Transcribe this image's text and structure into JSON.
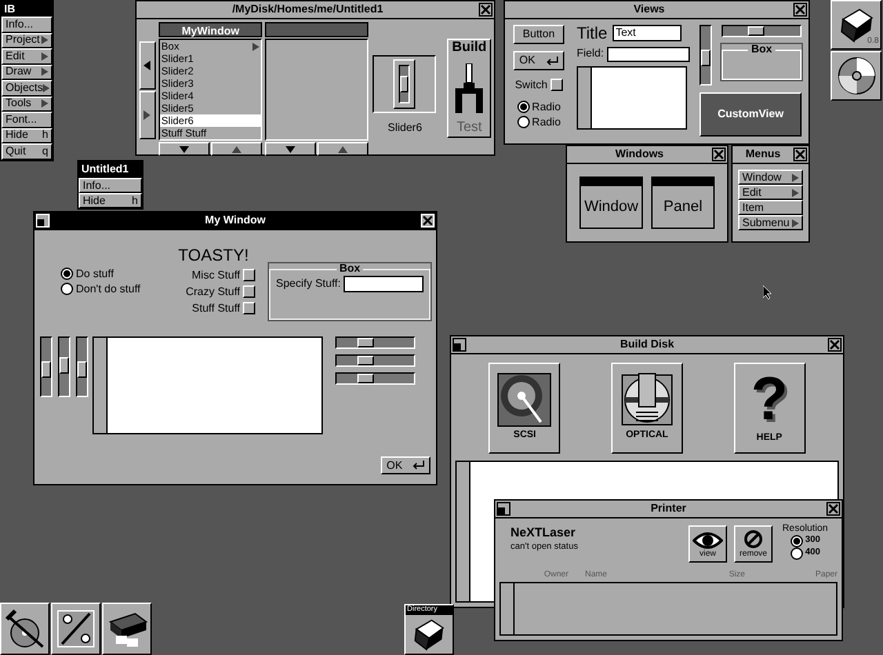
{
  "main_menu": {
    "title": "IB",
    "items": [
      {
        "label": "Info...",
        "kind": "plain"
      },
      {
        "label": "Project",
        "kind": "submenu"
      },
      {
        "label": "Edit",
        "kind": "submenu"
      },
      {
        "label": "Draw",
        "kind": "submenu"
      },
      {
        "label": "Objects",
        "kind": "submenu"
      },
      {
        "label": "Tools",
        "kind": "submenu"
      },
      {
        "label": "Font...",
        "kind": "plain"
      },
      {
        "label": "Hide",
        "kind": "shortcut",
        "shortcut": "h"
      },
      {
        "label": "Quit",
        "kind": "shortcut",
        "shortcut": "q"
      }
    ]
  },
  "document_menu": {
    "title": "Untitled1",
    "items": [
      {
        "label": "Info...",
        "kind": "plain"
      },
      {
        "label": "Hide",
        "kind": "shortcut",
        "shortcut": "h"
      }
    ]
  },
  "browser_window": {
    "title": "/MyDisk/Homes/me/Untitled1",
    "active": false,
    "column_title": "MyWindow",
    "items": [
      {
        "label": "Box",
        "kind": "branch",
        "selected": false
      },
      {
        "label": "Slider1",
        "kind": "leaf",
        "selected": false
      },
      {
        "label": "Slider2",
        "kind": "leaf",
        "selected": false
      },
      {
        "label": "Slider3",
        "kind": "leaf",
        "selected": false
      },
      {
        "label": "Slider4",
        "kind": "leaf",
        "selected": false
      },
      {
        "label": "Slider5",
        "kind": "leaf",
        "selected": false
      },
      {
        "label": "Slider6",
        "kind": "leaf",
        "selected": true
      },
      {
        "label": "Stuff Stuff",
        "kind": "leaf",
        "selected": false
      }
    ],
    "inspector_label": "Slider6",
    "inspector_slider": {
      "level": 0.5
    },
    "build_label": "Build",
    "test_label": "Test"
  },
  "views_window": {
    "title": "Views",
    "active": false,
    "button": "Button",
    "ok_button": "OK",
    "switch": {
      "label": "Switch",
      "checked": false
    },
    "radios": [
      {
        "label": "Radio",
        "selected": true
      },
      {
        "label": "Radio",
        "selected": false
      }
    ],
    "title_label": "Title",
    "text_field": "Text",
    "field_label": "Field:",
    "vertical_slider": {
      "level": 0.45
    },
    "horizontal_slider": {
      "level": 0.4
    },
    "box_title": "Box",
    "custom_view": "CustomView"
  },
  "windows_palette": {
    "title": "Windows",
    "active": false,
    "items": [
      "Window",
      "Panel"
    ]
  },
  "menus_palette": {
    "title": "Menus",
    "active": false,
    "items": [
      {
        "label": "Window",
        "kind": "submenu"
      },
      {
        "label": "Edit",
        "kind": "submenu"
      },
      {
        "label": "Item",
        "kind": "plain"
      },
      {
        "label": "Submenu",
        "kind": "submenu"
      }
    ]
  },
  "dock": {
    "version": "0.8"
  },
  "my_window": {
    "title": "My Window",
    "active": true,
    "heading": "TOASTY!",
    "radios": [
      {
        "label": "Do stuff",
        "selected": true
      },
      {
        "label": "Don't do stuff",
        "selected": false
      }
    ],
    "switches": [
      {
        "label": "Misc Stuff",
        "checked": false
      },
      {
        "label": "Crazy Stuff",
        "checked": false
      },
      {
        "label": "Stuff Stuff",
        "checked": false
      }
    ],
    "box_title": "Box",
    "box_label": "Specify Stuff:",
    "vertical_sliders": [
      {
        "level": 0.45
      },
      {
        "level": 0.55
      },
      {
        "level": 0.45
      }
    ],
    "horizontal_sliders": [
      {
        "level": 0.35
      },
      {
        "level": 0.35
      },
      {
        "level": 0.35
      }
    ],
    "ok_button": "OK"
  },
  "build_disk_window": {
    "title": "Build Disk",
    "active": false,
    "buttons": [
      {
        "label": "SCSI",
        "kind": "disk"
      },
      {
        "label": "OPTICAL",
        "kind": "optical"
      },
      {
        "label": "HELP",
        "kind": "help",
        "symbol": "?"
      }
    ]
  },
  "printer_window": {
    "title": "Printer",
    "active": false,
    "printer_name": "NeXTLaser",
    "status": "can't open status",
    "view_button": "view",
    "remove_button": "remove",
    "resolution_label": "Resolution",
    "resolutions": [
      {
        "label": "300",
        "selected": true
      },
      {
        "label": "400",
        "selected": false
      }
    ],
    "columns": [
      "Owner",
      "Name",
      "Size",
      "Paper"
    ]
  },
  "miniwindow": {
    "title": "Directory"
  }
}
